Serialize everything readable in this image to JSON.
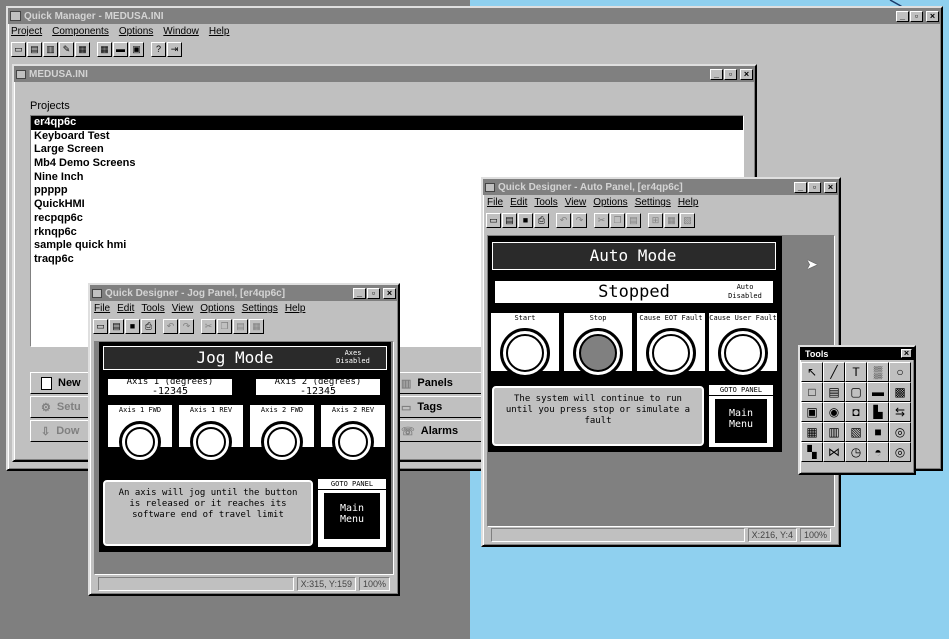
{
  "main_window": {
    "title": "Quick Manager - MEDUSA.INI",
    "menu": [
      "Project",
      "Components",
      "Options",
      "Window",
      "Help"
    ]
  },
  "child_window": {
    "title": "MEDUSA.INI",
    "projects_label": "Projects",
    "projects": [
      "er4qp6c",
      "Keyboard Test",
      "Large Screen",
      "Mb4 Demo Screens",
      "Nine Inch",
      "ppppp",
      "QuickHMI",
      "recpqp6c",
      "rknqp6c",
      "sample quick hmi",
      "traqp6c"
    ],
    "selected_index": 0,
    "left_buttons": [
      "New",
      "Setu",
      "Dow"
    ],
    "right_buttons": [
      "Panels",
      "Tags",
      "Alarms"
    ]
  },
  "jog_window": {
    "title": "Quick Designer - Jog Panel, [er4qp6c]",
    "menu": [
      "File",
      "Edit",
      "Tools",
      "View",
      "Options",
      "Settings",
      "Help"
    ],
    "panel_title": "Jog Mode",
    "badge": "Axes\nDisabled",
    "axis1_label": "Axis 1 (degrees)",
    "axis1_value": "-12345",
    "axis2_label": "Axis 2 (degrees)",
    "axis2_value": "-12345",
    "knob_labels": [
      "Axis 1 FWD",
      "Axis 1 REV",
      "Axis 2 FWD",
      "Axis 2 REV"
    ],
    "message": "An axis will jog until the button is released or it reaches its software end of travel limit",
    "goto_label": "GOTO PANEL",
    "goto_target": "Main\nMenu",
    "status_coords": "X:315, Y:159",
    "status_zoom": "100%"
  },
  "auto_window": {
    "title": "Quick Designer - Auto Panel, [er4qp6c]",
    "menu": [
      "File",
      "Edit",
      "Tools",
      "View",
      "Options",
      "Settings",
      "Help"
    ],
    "panel_title": "Auto Mode",
    "state": "Stopped",
    "badge": "Auto\nDisabled",
    "knob_labels": [
      "Start",
      "Stop",
      "Cause EOT Fault",
      "Cause User Fault"
    ],
    "message": "The system will continue to run until you press stop or simulate a fault",
    "goto_label": "GOTO PANEL",
    "goto_target": "Main\nMenu",
    "status_coords": "X:216, Y:4",
    "status_zoom": "100%"
  },
  "tools_window": {
    "title": "Tools"
  }
}
